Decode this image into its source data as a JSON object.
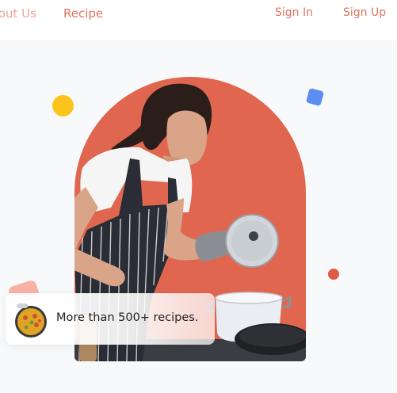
{
  "nav": {
    "about_label": "About Us",
    "recipe_label": "Recipe",
    "signin_label": "Sign In",
    "signup_label": "Sign Up"
  },
  "hero": {
    "image_subject": "woman-cooking-photo"
  },
  "badge": {
    "text": "More than 500+ recipes.",
    "thumb_icon": "paella-dish-icon"
  },
  "colors": {
    "accent": "#e0735c",
    "arch": "#e0664f",
    "yellow_dot": "#fcc419",
    "blue_dot": "#5c8ef2",
    "red_dot": "#e05a48",
    "pink_dot": "#f7b2a5",
    "background": "#f8f9fb"
  }
}
